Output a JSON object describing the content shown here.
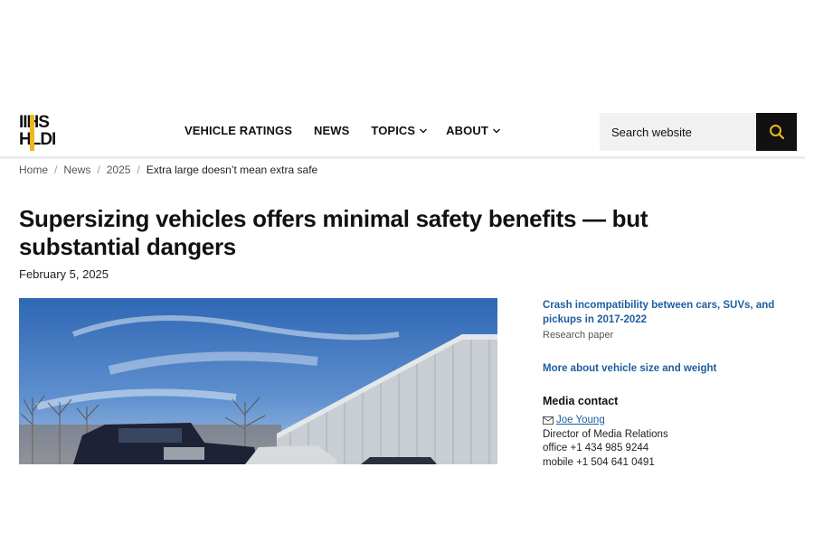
{
  "logo": {
    "line1": "IIHS",
    "line2": "HLDI"
  },
  "nav": {
    "vehicle_ratings": "VEHICLE RATINGS",
    "news": "NEWS",
    "topics": "TOPICS",
    "about": "ABOUT"
  },
  "search": {
    "placeholder": "Search website"
  },
  "breadcrumb": {
    "home": "Home",
    "news": "News",
    "year": "2025",
    "current": "Extra large doesn’t mean extra safe"
  },
  "article": {
    "title": "Supersizing vehicles offers minimal safety benefits — but substantial dangers",
    "date": "February 5, 2025"
  },
  "sidebar": {
    "related_link": "Crash incompatibility between cars, SUVs, and pickups in 2017-2022",
    "related_type": "Research paper",
    "more_link": "More about vehicle size and weight",
    "media_contact_title": "Media contact",
    "contact_name": "Joe Young",
    "contact_role": "Director of Media Relations",
    "office": "office +1 434 985 9244",
    "mobile": "mobile +1 504 641 0491"
  },
  "colors": {
    "accent": "#f2b51c",
    "link": "#1c5e9e",
    "search_button": "#111111"
  }
}
